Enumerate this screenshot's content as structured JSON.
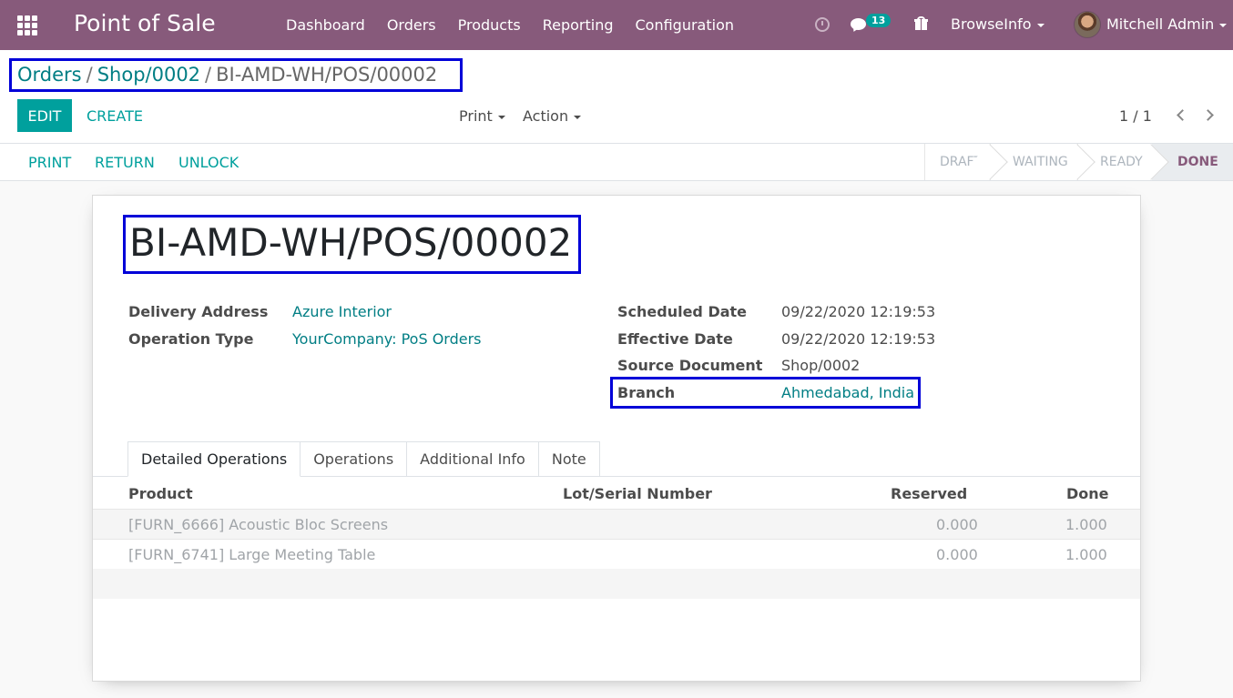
{
  "navbar": {
    "app_title": "Point of Sale",
    "menu": [
      "Dashboard",
      "Orders",
      "Products",
      "Reporting",
      "Configuration"
    ],
    "message_count": "13",
    "company": "BrowseInfo",
    "user": "Mitchell Admin",
    "icons": [
      "apps-grid-icon",
      "activity-clock-icon",
      "chat-icon",
      "gift-icon"
    ]
  },
  "breadcrumb": {
    "item1": "Orders",
    "item2": "Shop/0002",
    "current": "BI-AMD-WH/POS/00002",
    "separator": "/"
  },
  "toolbar": {
    "edit": "EDIT",
    "create": "CREATE",
    "print": "Print",
    "action": "Action",
    "pager": "1 / 1"
  },
  "statusbar": {
    "buttons": [
      "PRINT",
      "RETURN",
      "UNLOCK"
    ],
    "stages": [
      "DRAFT",
      "WAITING",
      "READY",
      "DONE"
    ],
    "current_stage": "DONE"
  },
  "record": {
    "name": "BI-AMD-WH/POS/00002",
    "left_fields": [
      {
        "label": "Delivery Address",
        "value": "Azure Interior"
      },
      {
        "label": "Operation Type",
        "value": "YourCompany: PoS Orders"
      }
    ],
    "right_fields": [
      {
        "label": "Scheduled Date",
        "value": "09/22/2020 12:19:53"
      },
      {
        "label": "Effective Date",
        "value": "09/22/2020 12:19:53"
      },
      {
        "label": "Source Document",
        "value": "Shop/0002"
      },
      {
        "label": "Branch",
        "value": "Ahmedabad, India"
      }
    ]
  },
  "tabs": [
    "Detailed Operations",
    "Operations",
    "Additional Info",
    "Note"
  ],
  "table": {
    "headers": [
      "Product",
      "Lot/Serial Number",
      "Reserved",
      "Done"
    ],
    "rows": [
      {
        "product": "[FURN_6666] Acoustic Bloc Screens",
        "lot": "",
        "reserved": "0.000",
        "done": "1.000"
      },
      {
        "product": "[FURN_6741] Large Meeting Table",
        "lot": "",
        "reserved": "0.000",
        "done": "1.000"
      }
    ]
  },
  "colors": {
    "navbar": "#875a7b",
    "primary": "#00a09d",
    "link": "#017e84",
    "highlight": "#0000d8"
  }
}
